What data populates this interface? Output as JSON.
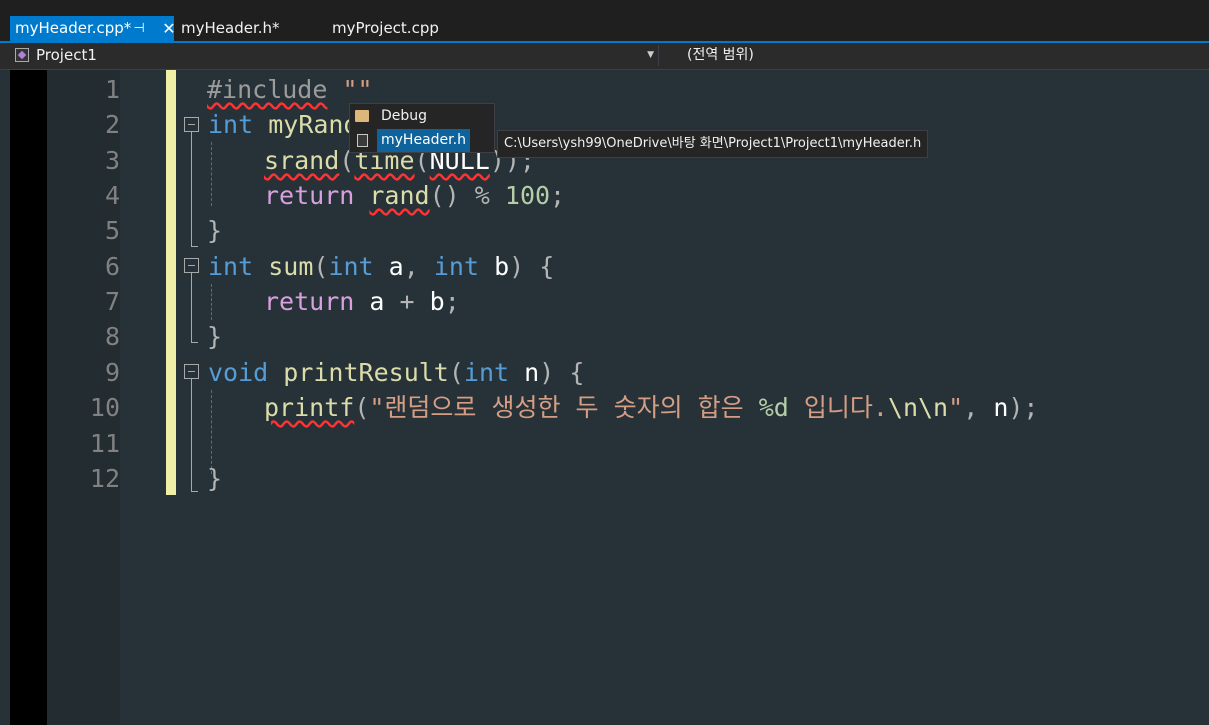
{
  "tabs": [
    {
      "label": "myHeader.cpp*",
      "active": true
    },
    {
      "label": "myHeader.h*",
      "active": false
    },
    {
      "label": "myProject.cpp",
      "active": false
    }
  ],
  "tab_icons": {
    "pin": "⊣",
    "close": "✕"
  },
  "navbar": {
    "project_scope": "Project1",
    "member_scope": "(전역 범위)"
  },
  "editor": {
    "line_numbers": [
      "1",
      "2",
      "3",
      "4",
      "5",
      "6",
      "7",
      "8",
      "9",
      "10",
      "11",
      "12"
    ],
    "code": {
      "l1_directive": "#include",
      "l1_string": "\"\"",
      "l2_type": "int",
      "l2_name": "myRand",
      "l3_fn": "srand",
      "l3_open": "(",
      "l3_time": "time",
      "l3_open2": "(",
      "l3_null": "NULL",
      "l3_close": "));",
      "l4_kw": "return",
      "l4_fn": "rand",
      "l4_parens": "()",
      "l4_op": "%",
      "l4_num": "100",
      "l4_semi": ";",
      "l5_brace": "}",
      "l6_type": "int",
      "l6_name": "sum",
      "l6_open": "(",
      "l6_t1": "int",
      "l6_a": "a",
      "l6_comma": ",",
      "l6_t2": "int",
      "l6_b": "b",
      "l6_close": ")",
      "l6_brace": "{",
      "l7_kw": "return",
      "l7_a": "a",
      "l7_op": "+",
      "l7_b": "b",
      "l7_semi": ";",
      "l8_brace": "}",
      "l9_type": "void",
      "l9_name": "printResult",
      "l9_open": "(",
      "l9_t": "int",
      "l9_n": "n",
      "l9_close": ")",
      "l9_brace": "{",
      "l10_fn": "printf",
      "l10_open": "(",
      "l10_str": "\"랜덤으로 생성한 두 숫자의 합은 ",
      "l10_fmt": "%d",
      "l10_str2": " 입니다.",
      "l10_esc": "\\n\\n",
      "l10_str3": "\"",
      "l10_comma": ",",
      "l10_n": "n",
      "l10_close": ");",
      "l12_brace": "}"
    }
  },
  "completion": {
    "items": [
      {
        "label": "Debug",
        "icon": "folder-icon"
      },
      {
        "label": "myHeader.h",
        "icon": "header-file-icon",
        "selected": true
      }
    ],
    "tooltip": "C:\\Users\\ysh99\\OneDrive\\바탕 화면\\Project1\\Project1\\myHeader.h"
  },
  "colors": {
    "accent": "#007acc",
    "editor_bg": "#263238",
    "change_bar": "#eff0a5",
    "squiggle": "#ff3333"
  }
}
